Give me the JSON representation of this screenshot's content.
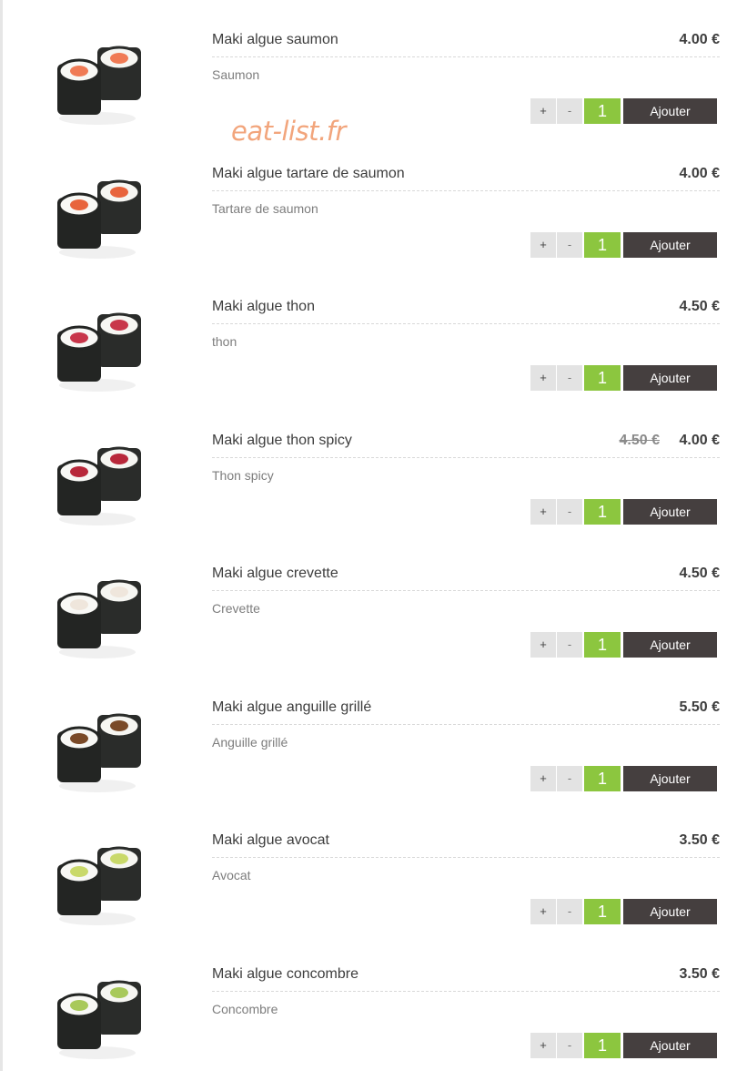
{
  "currency": "€",
  "watermark": "eat-list.fr",
  "controls": {
    "plus": "+",
    "minus": "-",
    "add": "Ajouter"
  },
  "colors": {
    "accent_green": "#8cc63f",
    "add_button": "#453f3f",
    "watermark": "#f2a57c"
  },
  "items": [
    {
      "name": "Maki algue saumon",
      "description": "Saumon",
      "price": "4.00 €",
      "old_price": "",
      "quantity": "1",
      "image": "maki-salmon-image",
      "filling": "#f07b55"
    },
    {
      "name": "Maki algue tartare de saumon",
      "description": "Tartare de saumon",
      "price": "4.00 €",
      "old_price": "",
      "quantity": "1",
      "image": "maki-salmon-tartare-image",
      "filling": "#e8643c"
    },
    {
      "name": "Maki algue thon",
      "description": "thon",
      "price": "4.50 €",
      "old_price": "",
      "quantity": "1",
      "image": "maki-tuna-image",
      "filling": "#c8364a"
    },
    {
      "name": "Maki algue thon spicy",
      "description": "Thon spicy",
      "price": "4.00 €",
      "old_price": "4.50 €",
      "quantity": "1",
      "image": "maki-spicy-tuna-image",
      "filling": "#b8283a"
    },
    {
      "name": "Maki algue crevette",
      "description": "Crevette",
      "price": "4.50 €",
      "old_price": "",
      "quantity": "1",
      "image": "maki-shrimp-image",
      "filling": "#efe6dc"
    },
    {
      "name": "Maki algue anguille grillé",
      "description": "Anguille grillé",
      "price": "5.50 €",
      "old_price": "",
      "quantity": "1",
      "image": "maki-eel-image",
      "filling": "#7a4a28"
    },
    {
      "name": "Maki algue avocat",
      "description": "Avocat",
      "price": "3.50 €",
      "old_price": "",
      "quantity": "1",
      "image": "maki-avocado-image",
      "filling": "#c9d96a"
    },
    {
      "name": "Maki algue concombre",
      "description": "Concombre",
      "price": "3.50 €",
      "old_price": "",
      "quantity": "1",
      "image": "maki-cucumber-image",
      "filling": "#a8c95a"
    }
  ]
}
